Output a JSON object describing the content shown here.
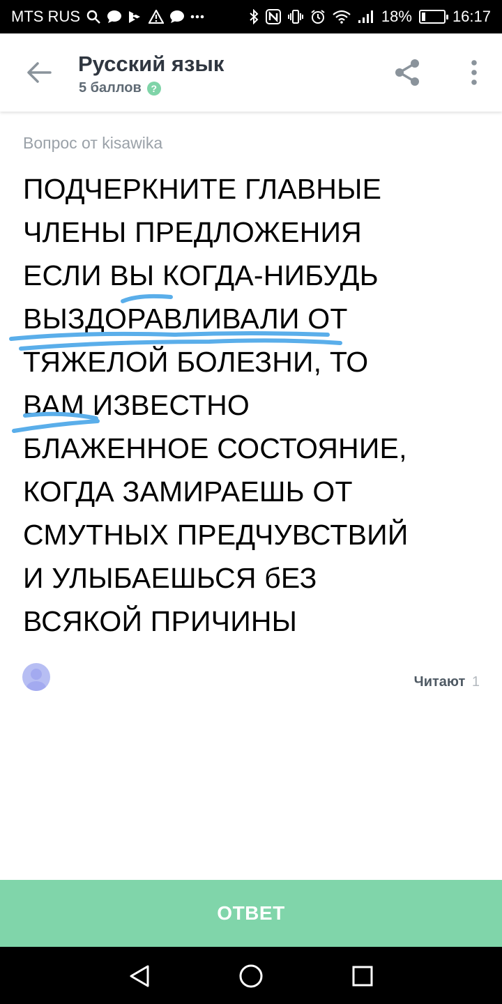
{
  "status_bar": {
    "carrier": "MTS RUS",
    "battery_percent": "18%",
    "battery_level": 0.18,
    "time": "16:17",
    "icons_left": [
      "search-icon",
      "chat-icon",
      "app-icon",
      "warning-icon",
      "chat-icon",
      "more-icon"
    ],
    "icons_right": [
      "bluetooth-icon",
      "nfc-icon",
      "vibrate-icon",
      "alarm-icon",
      "wifi-icon",
      "signal-icon",
      "battery-icon"
    ]
  },
  "header": {
    "title": "Русский язык",
    "points": "5 баллов",
    "help_symbol": "?"
  },
  "question": {
    "asker": "Вопрос от kisawika",
    "lines": [
      "ПОДЧЕРКНИТЕ ГЛАВНЫЕ",
      "ЧЛЕНЫ ПРЕДЛОЖЕНИЯ",
      "ЕСЛИ ВЫ КОГДА-НИБУДЬ",
      "ВЫЗДОРАВЛИВАЛИ ОТ",
      "ТЯЖЕЛОЙ БОЛЕЗНИ, ТО",
      "ВАМ ИЗВЕСТНО",
      "БЛАЖЕННОЕ СОСТОЯНИЕ,",
      "КОГДА ЗАМИРАЕШЬ ОТ",
      "СМУТНЫХ ПРЕДЧУВСТВИЙ",
      "И УЛЫБАЕШЬСЯ бЕЗ",
      "ВСЯКОЙ ПРИЧИНЫ"
    ],
    "underline_color": "#5aaeea"
  },
  "footer_info": {
    "reading_label": "Читают",
    "reading_count": "1"
  },
  "answer_button": {
    "label": "ОТВЕТ"
  },
  "colors": {
    "accent": "#80d5aa",
    "title": "#2f3640",
    "muted": "#9aa1a8"
  }
}
